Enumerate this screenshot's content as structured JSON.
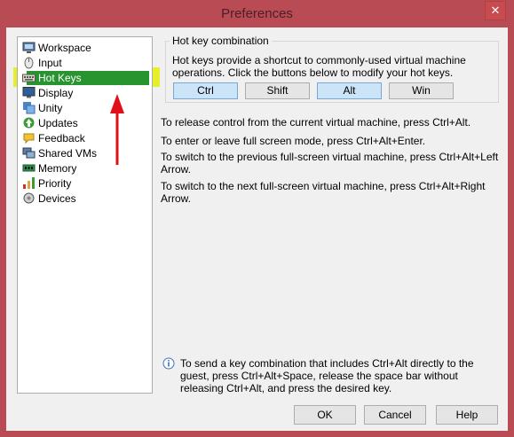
{
  "window": {
    "title": "Preferences",
    "close_glyph": "✕"
  },
  "sidebar": {
    "items": [
      {
        "label": "Workspace",
        "icon": "workspace-icon"
      },
      {
        "label": "Input",
        "icon": "input-icon"
      },
      {
        "label": "Hot Keys",
        "icon": "hot-keys-icon",
        "selected": true
      },
      {
        "label": "Display",
        "icon": "display-icon"
      },
      {
        "label": "Unity",
        "icon": "unity-icon"
      },
      {
        "label": "Updates",
        "icon": "updates-icon"
      },
      {
        "label": "Feedback",
        "icon": "feedback-icon"
      },
      {
        "label": "Shared VMs",
        "icon": "shared-vms-icon"
      },
      {
        "label": "Memory",
        "icon": "memory-icon"
      },
      {
        "label": "Priority",
        "icon": "priority-icon"
      },
      {
        "label": "Devices",
        "icon": "devices-icon"
      }
    ]
  },
  "hotkeys": {
    "group_title": "Hot key combination",
    "description": "Hot keys provide a shortcut to commonly-used virtual machine operations. Click the buttons below to modify your hot keys.",
    "buttons": [
      {
        "label": "Ctrl",
        "active": true
      },
      {
        "label": "Shift",
        "active": false
      },
      {
        "label": "Alt",
        "active": true
      },
      {
        "label": "Win",
        "active": false
      }
    ]
  },
  "info": {
    "lines": [
      "To release control from the current virtual machine, press Ctrl+Alt.",
      "To enter or leave full screen mode, press Ctrl+Alt+Enter.",
      "To switch to the previous full-screen virtual machine, press Ctrl+Alt+Left Arrow.",
      "To switch to the next full-screen virtual machine, press Ctrl+Alt+Right Arrow."
    ]
  },
  "tip": {
    "text": "To send a key combination that includes Ctrl+Alt directly to the guest, press Ctrl+Alt+Space, release the space bar without releasing Ctrl+Alt, and press the desired key."
  },
  "footer": {
    "ok_label": "OK",
    "cancel_label": "Cancel",
    "help_label": "Help"
  },
  "colors": {
    "titlebar": "#b94b55",
    "highlight_yellow": "#e6ef2b",
    "selected_green": "#28942f",
    "arrow_red": "#e0101a"
  }
}
